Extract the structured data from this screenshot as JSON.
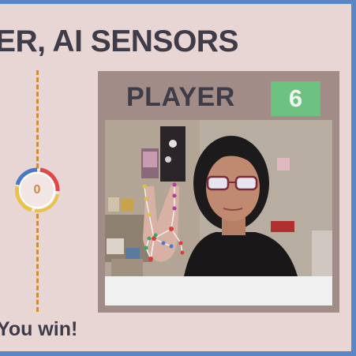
{
  "header": {
    "title": "ER, AI SENSORS"
  },
  "round_counter": {
    "value": "0"
  },
  "result": {
    "text": "You win!"
  },
  "player": {
    "label": "PLAYER",
    "score": "6"
  },
  "colors": {
    "border_blue": "#5b86c6",
    "background": "#e7d6d4",
    "panel": "#a18c87",
    "score_green": "#6dc282",
    "divider_orange": "#d08b3a",
    "text_dark": "#3e3c48"
  },
  "camera": {
    "gesture": "peace-sign",
    "landmark_overlay": true
  }
}
